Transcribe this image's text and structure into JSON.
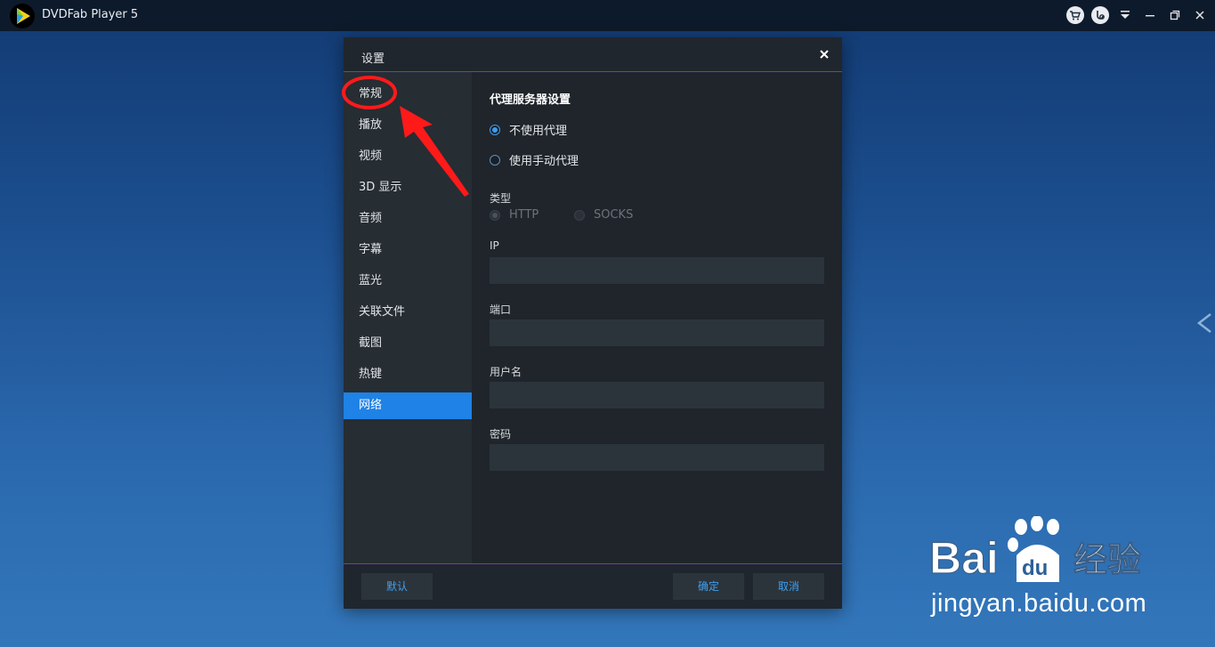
{
  "app": {
    "title": "DVDFab Player 5"
  },
  "window_controls": {
    "icons": [
      "cart-icon",
      "plugin-icon",
      "menu-dropdown-icon",
      "minimize-icon",
      "restore-icon",
      "close-icon"
    ]
  },
  "dialog": {
    "title": "设置",
    "sidebar": {
      "items": [
        {
          "label": "常规",
          "active": false
        },
        {
          "label": "播放",
          "active": false
        },
        {
          "label": "视频",
          "active": false
        },
        {
          "label": "3D 显示",
          "active": false
        },
        {
          "label": "音频",
          "active": false
        },
        {
          "label": "字幕",
          "active": false
        },
        {
          "label": "蓝光",
          "active": false
        },
        {
          "label": "关联文件",
          "active": false
        },
        {
          "label": "截图",
          "active": false
        },
        {
          "label": "热键",
          "active": false
        },
        {
          "label": "网络",
          "active": true
        }
      ]
    },
    "content": {
      "section_title": "代理服务器设置",
      "proxy_options": [
        {
          "label": "不使用代理",
          "checked": true
        },
        {
          "label": "使用手动代理",
          "checked": false
        }
      ],
      "type_label": "类型",
      "type_options": [
        {
          "label": "HTTP",
          "checked": true,
          "disabled": true
        },
        {
          "label": "SOCKS",
          "checked": false,
          "disabled": true
        }
      ],
      "ip_label": "IP",
      "ip_value": "",
      "port_label": "端口",
      "port_value": "",
      "username_label": "用户名",
      "username_value": "",
      "password_label": "密码",
      "password_value": ""
    },
    "footer": {
      "default_label": "默认",
      "ok_label": "确定",
      "cancel_label": "取消"
    }
  },
  "colors": {
    "accent": "#1f82e6",
    "annotation": "#ff1a1a",
    "divider": "#6c3fb1"
  },
  "watermark": {
    "brand": "Bai du 经验",
    "url": "jingyan.baidu.com"
  }
}
